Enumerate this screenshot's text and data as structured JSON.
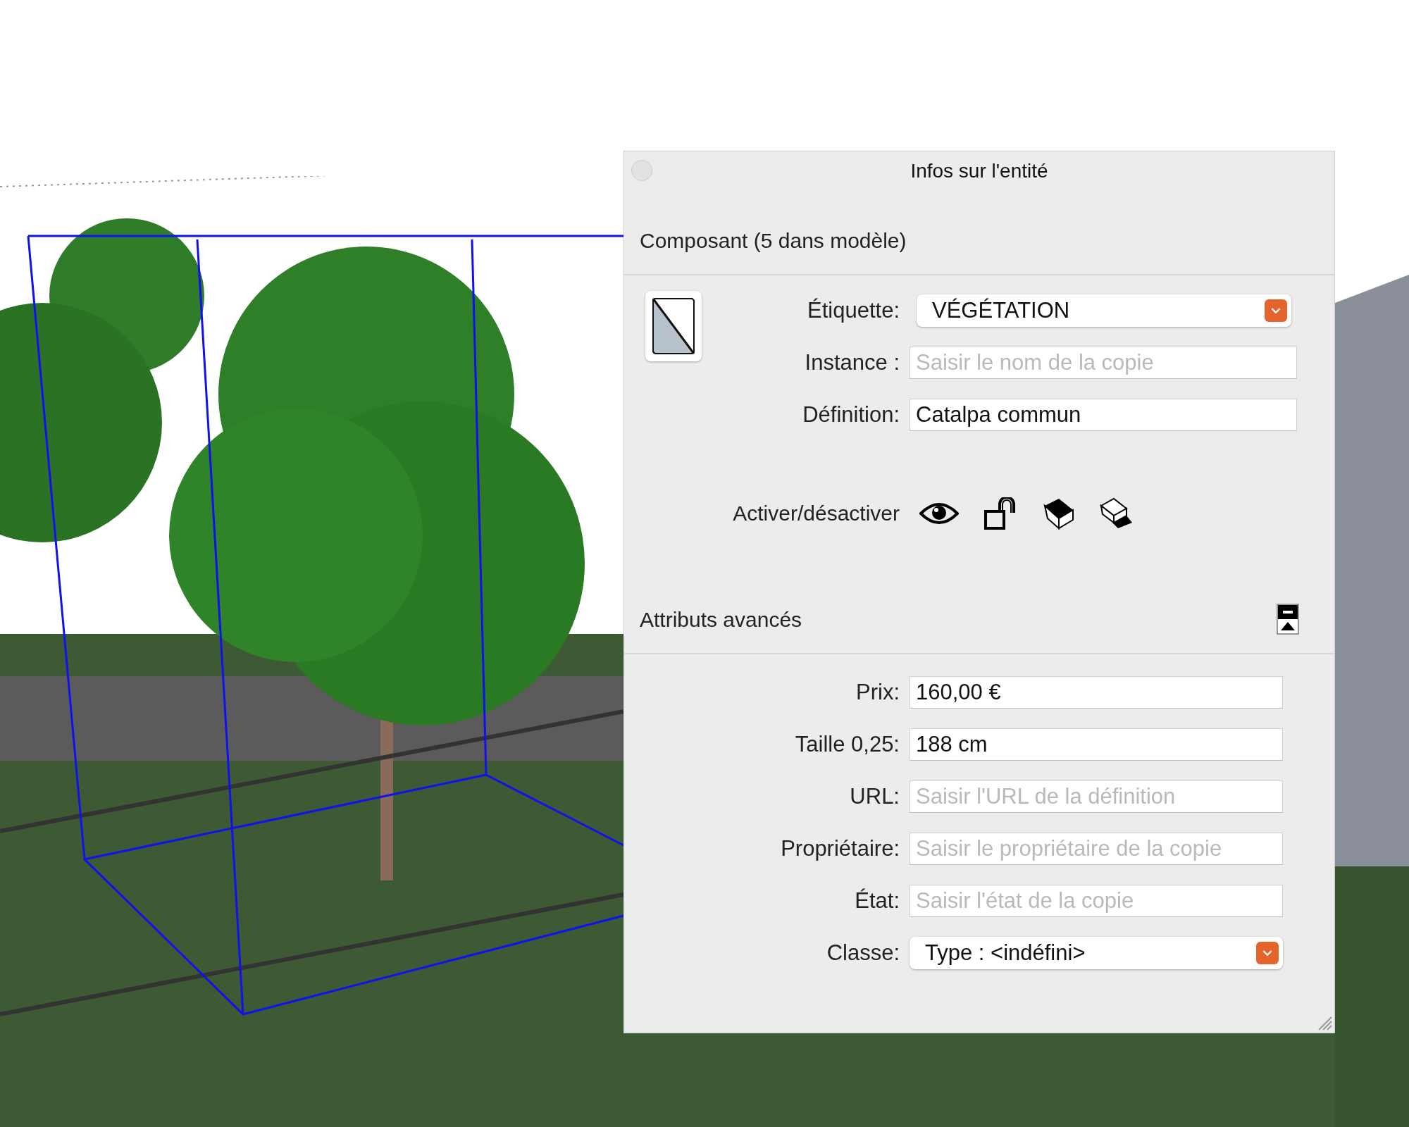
{
  "window": {
    "title": "Infos sur l'entité"
  },
  "section": {
    "title": "Composant (5 dans modèle)"
  },
  "fields": [
    {
      "kind": "dropdown",
      "label": "Étiquette:",
      "value": "VÉGÉTATION"
    },
    {
      "kind": "text",
      "label": "Instance :",
      "placeholder": "Saisir le nom de la copie"
    },
    {
      "kind": "text",
      "label": "Définition:",
      "value": "Catalpa commun"
    }
  ],
  "toggles": {
    "label": "Activer/désactiver",
    "icons": [
      {
        "kind": "eye"
      },
      {
        "kind": "lock"
      },
      {
        "kind": "receive-shadow"
      },
      {
        "kind": "cast-shadow"
      }
    ]
  },
  "advanced": {
    "title": "Attributs avancés",
    "expanded": true,
    "fields": [
      {
        "kind": "text",
        "label": "Prix:",
        "value": "160,00 €"
      },
      {
        "kind": "text",
        "label": "Taille 0,25:",
        "value": "188 cm"
      },
      {
        "kind": "text",
        "label": "URL:",
        "placeholder": "Saisir l'URL de la définition"
      },
      {
        "kind": "text",
        "label": "Propriétaire:",
        "placeholder": "Saisir le propriétaire de la copie"
      },
      {
        "kind": "text",
        "label": "État:",
        "placeholder": "Saisir l'état de la copie"
      },
      {
        "kind": "dropdown",
        "label": "Classe:",
        "value": "Type : <indéfini>"
      }
    ]
  }
}
